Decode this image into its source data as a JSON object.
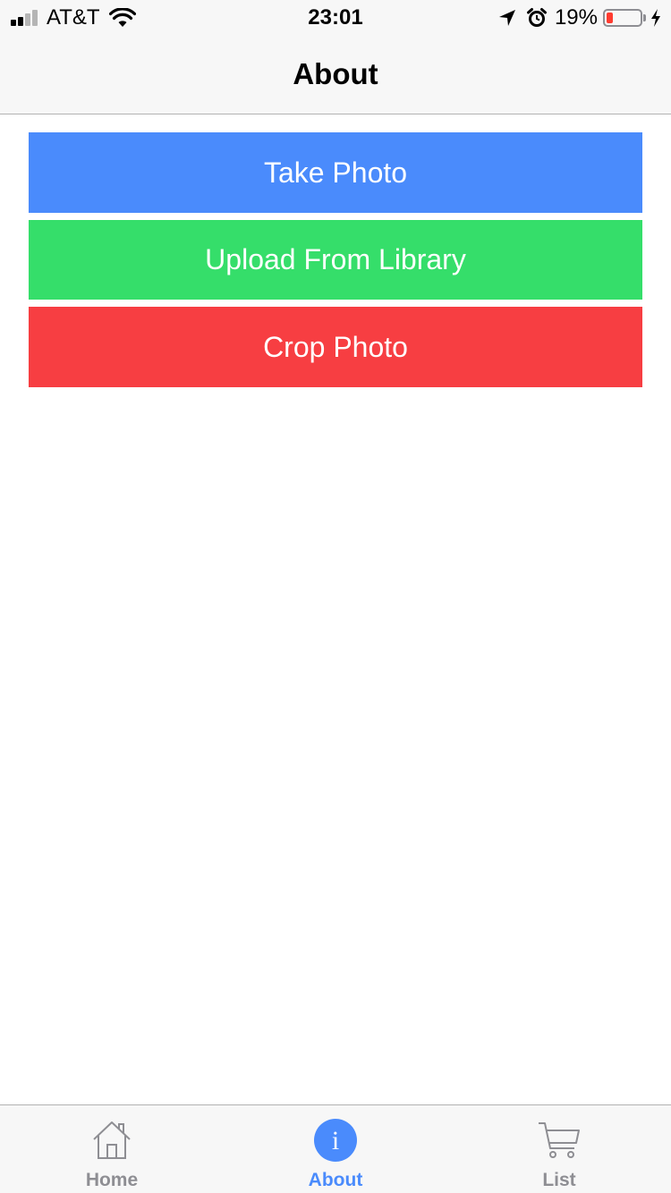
{
  "status_bar": {
    "carrier": "AT&T",
    "time": "23:01",
    "battery_percent": "19%",
    "battery_level": 0.19,
    "battery_color": "#ff3b30",
    "icons": [
      "signal-icon",
      "wifi-icon",
      "location-icon",
      "alarm-icon",
      "battery-icon",
      "charging-icon"
    ]
  },
  "nav": {
    "title": "About"
  },
  "buttons": {
    "take_photo": {
      "label": "Take Photo",
      "color": "#4a8bfc"
    },
    "upload_library": {
      "label": "Upload From Library",
      "color": "#35de6a"
    },
    "crop_photo": {
      "label": "Crop Photo",
      "color": "#f73e42"
    }
  },
  "tab_bar": {
    "active_color": "#4a8bfc",
    "inactive_color": "#8e8e93",
    "tabs": [
      {
        "label": "Home",
        "icon": "home-icon",
        "active": false
      },
      {
        "label": "About",
        "icon": "info-icon",
        "active": true
      },
      {
        "label": "List",
        "icon": "cart-icon",
        "active": false
      }
    ]
  }
}
